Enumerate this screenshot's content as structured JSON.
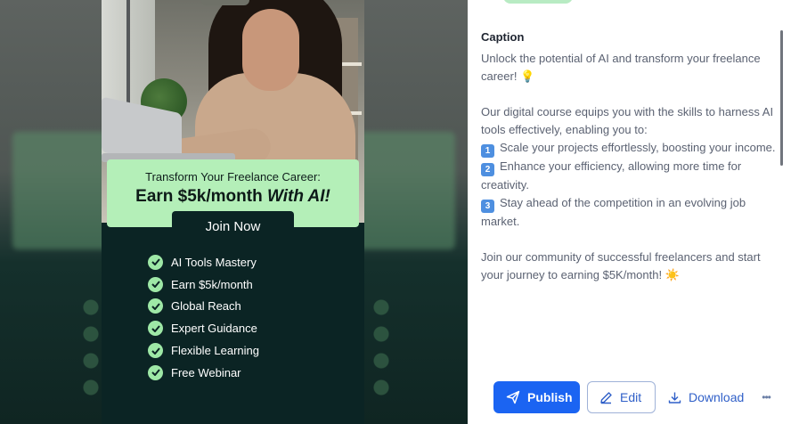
{
  "post": {
    "headline_line1": "Transform Your Freelance Career:",
    "headline_main": "Earn $5k/month",
    "headline_accent": "With AI!",
    "cta": "Join Now",
    "features": [
      "AI Tools Mastery",
      "Earn $5k/month",
      "Global Reach",
      "Expert Guidance",
      "Flexible Learning",
      "Free Webinar"
    ]
  },
  "caption": {
    "title": "Caption",
    "intro": "Unlock the potential of AI and transform your freelance career! 💡",
    "lead": "Our digital course equips you with the skills to harness AI tools effectively, enabling you to:",
    "points": [
      {
        "num": "1",
        "text": "Scale your projects effortlessly, boosting your income."
      },
      {
        "num": "2",
        "text": "Enhance your efficiency, allowing more time for creativity."
      },
      {
        "num": "3",
        "text": "Stay ahead of the competition in an evolving job market."
      }
    ],
    "outro": "Join our community of successful freelancers and start your journey to earning $5K/month! ☀️"
  },
  "actions": {
    "publish": "Publish",
    "edit": "Edit",
    "download": "Download",
    "more": "•••"
  },
  "colors": {
    "accent_green": "#b4efb8",
    "post_bg": "#0b2424",
    "publish_blue": "#1b64f2"
  },
  "icons": {
    "publish": "send-icon",
    "edit": "pencil-icon",
    "download": "download-icon",
    "more": "more-icon",
    "feature": "check-circle-icon"
  }
}
